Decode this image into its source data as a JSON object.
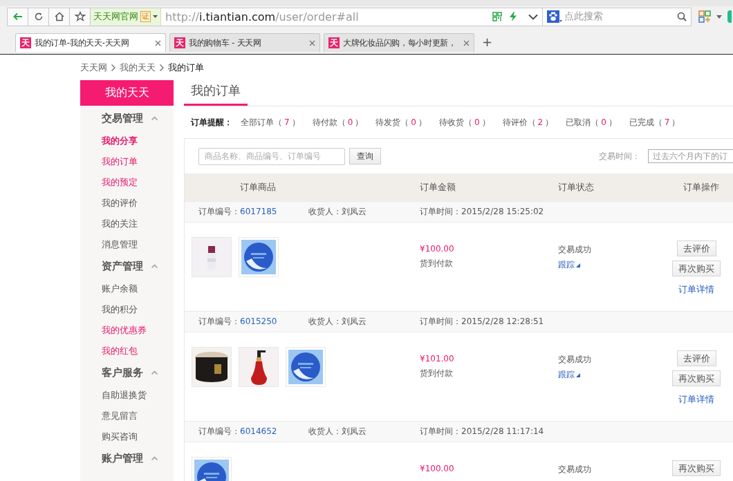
{
  "browser": {
    "site_badge": "天天网官网",
    "cert_badge": "证",
    "url": {
      "prefix": "http://",
      "host": "i.tiantian.com",
      "path": "/user/order#all"
    },
    "search": {
      "placeholder": "点此搜索"
    },
    "new_tab": "+"
  },
  "tabs": [
    {
      "favicon": "天",
      "label": "我的订单-我的天天-天天网",
      "selected": true
    },
    {
      "favicon": "天",
      "label": "我的购物车 - 天天网",
      "selected": false
    },
    {
      "favicon": "天",
      "label": "大牌化妆品闪购，每小时更新，",
      "selected": false
    }
  ],
  "breadcrumb": [
    "天天网",
    "我的天天",
    "我的订单"
  ],
  "sidebar": {
    "title": "我的天天",
    "groups": [
      {
        "label": "交易管理",
        "expanded": true,
        "items": [
          {
            "label": "我的分享",
            "highlighted": true,
            "selected": true
          },
          {
            "label": "我的订单",
            "highlighted": true,
            "selected": false
          },
          {
            "label": "我的预定",
            "highlighted": true,
            "selected": false
          },
          {
            "label": "我的评价",
            "highlighted": false,
            "selected": false
          },
          {
            "label": "我的关注",
            "highlighted": false,
            "selected": false
          },
          {
            "label": "消息管理",
            "highlighted": false,
            "selected": false
          }
        ]
      },
      {
        "label": "资产管理",
        "expanded": true,
        "items": [
          {
            "label": "账户余额",
            "highlighted": false,
            "selected": false
          },
          {
            "label": "我的积分",
            "highlighted": false,
            "selected": false
          },
          {
            "label": "我的优惠券",
            "highlighted": true,
            "selected": false
          },
          {
            "label": "我的红包",
            "highlighted": true,
            "selected": false
          }
        ]
      },
      {
        "label": "客户服务",
        "expanded": true,
        "items": [
          {
            "label": "自助退换货",
            "highlighted": false,
            "selected": false
          },
          {
            "label": "意见留言",
            "highlighted": false,
            "selected": false
          },
          {
            "label": "购买咨询",
            "highlighted": false,
            "selected": false
          }
        ]
      },
      {
        "label": "账户管理",
        "expanded": true
      }
    ]
  },
  "page_title": "我的订单",
  "filters": {
    "label": "订单提醒：",
    "items": [
      {
        "label": "全部订单（",
        "count": "7",
        "close": "）"
      },
      {
        "label": "待付款（",
        "count": "0",
        "close": "）"
      },
      {
        "label": "待发货（",
        "count": "0",
        "close": "）"
      },
      {
        "label": "待收货（",
        "count": "0",
        "close": "）"
      },
      {
        "label": "待评价（",
        "count": "2",
        "close": "）"
      },
      {
        "label": "已取消（",
        "count": "0",
        "close": "）"
      },
      {
        "label": "已完成（",
        "count": "7",
        "close": "）"
      }
    ]
  },
  "search": {
    "placeholder": "商品名称、商品编号、订单编号",
    "button": "查询",
    "date_label": "交易时间：",
    "date_value": "过去六个月内下的订"
  },
  "columns": [
    "订单商品",
    "订单金额",
    "订单状态",
    "订单操作"
  ],
  "orders": [
    {
      "number_label": "订单编号：",
      "number": "6017185",
      "receiver": "收货人：刘凤云",
      "time": "订单时间：2015/2/28 15:25:02",
      "products": [
        {
          "kind": "picture"
        },
        {
          "kind": "picture"
        }
      ],
      "amount": "¥100.00",
      "payment": "货到付款",
      "status": "交易成功",
      "track": "跟踪",
      "actions": [
        {
          "kind": "button",
          "label": "去评价"
        },
        {
          "kind": "button",
          "label": "再次购买"
        },
        {
          "kind": "link",
          "label": "订单详情"
        }
      ]
    },
    {
      "number_label": "订单编号：",
      "number": "6015250",
      "receiver": "收货人：刘凤云",
      "time": "订单时间：2015/2/28 12:28:51",
      "products": [
        {
          "kind": "picture"
        },
        {
          "kind": "picture"
        },
        {
          "kind": "picture"
        }
      ],
      "amount": "¥101.00",
      "payment": "货到付款",
      "status": "交易成功",
      "track": "跟踪",
      "actions": [
        {
          "kind": "button",
          "label": "去评价"
        },
        {
          "kind": "button",
          "label": "再次购买"
        },
        {
          "kind": "link",
          "label": "订单详情"
        }
      ]
    },
    {
      "number_label": "订单编号：",
      "number": "6014652",
      "receiver": "收货人：刘凤云",
      "time": "订单时间：2015/2/28 11:17:14",
      "products": [
        {
          "kind": "picture"
        }
      ],
      "amount": "¥100.00",
      "status": "交易成功",
      "actions": [
        {
          "kind": "button",
          "label": "再次购买"
        }
      ]
    }
  ]
}
